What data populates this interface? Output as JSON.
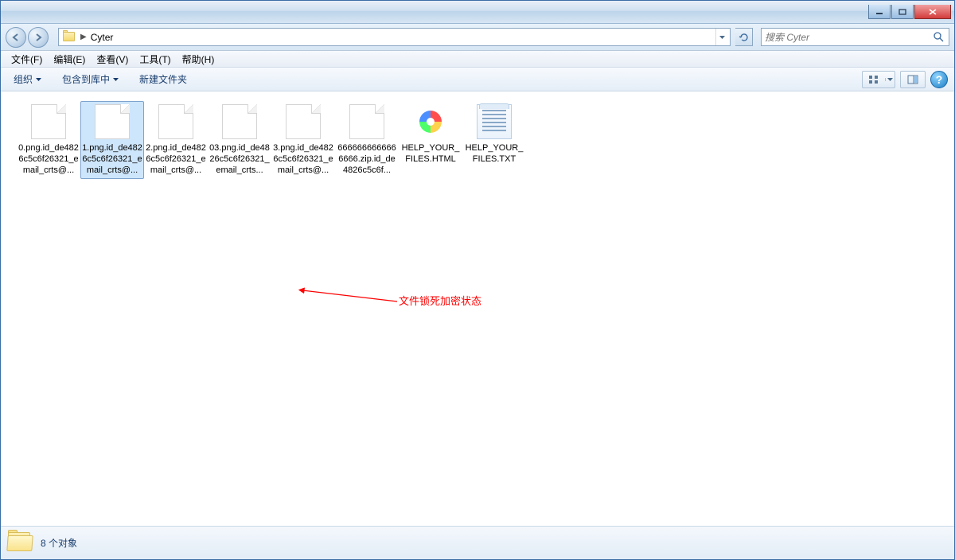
{
  "address": {
    "location": "Cyter",
    "separator": "▶"
  },
  "search": {
    "placeholder": "搜索 Cyter"
  },
  "menu": {
    "file": "文件(F)",
    "edit": "编辑(E)",
    "view": "查看(V)",
    "tools": "工具(T)",
    "help": "帮助(H)"
  },
  "toolbar": {
    "organize": "组织",
    "include": "包含到库中",
    "newfolder": "新建文件夹"
  },
  "files": [
    {
      "name": "0.png.id_de4826c5c6f26321_email_crts@...",
      "type": "blank",
      "selected": false
    },
    {
      "name": "1.png.id_de4826c5c6f26321_email_crts@...",
      "type": "blank",
      "selected": true
    },
    {
      "name": "2.png.id_de4826c5c6f26321_email_crts@...",
      "type": "blank",
      "selected": false
    },
    {
      "name": "03.png.id_de4826c5c6f26321_email_crts...",
      "type": "blank",
      "selected": false
    },
    {
      "name": "3.png.id_de4826c5c6f26321_email_crts@...",
      "type": "blank",
      "selected": false
    },
    {
      "name": "6666666666666666.zip.id_de4826c5c6f...",
      "type": "blank",
      "selected": false
    },
    {
      "name": "HELP_YOUR_FILES.HTML",
      "type": "html",
      "selected": false
    },
    {
      "name": "HELP_YOUR_FILES.TXT",
      "type": "txt",
      "selected": false
    }
  ],
  "annotation": "文件锁死加密状态",
  "status": {
    "text": "8 个对象"
  },
  "help": "?"
}
